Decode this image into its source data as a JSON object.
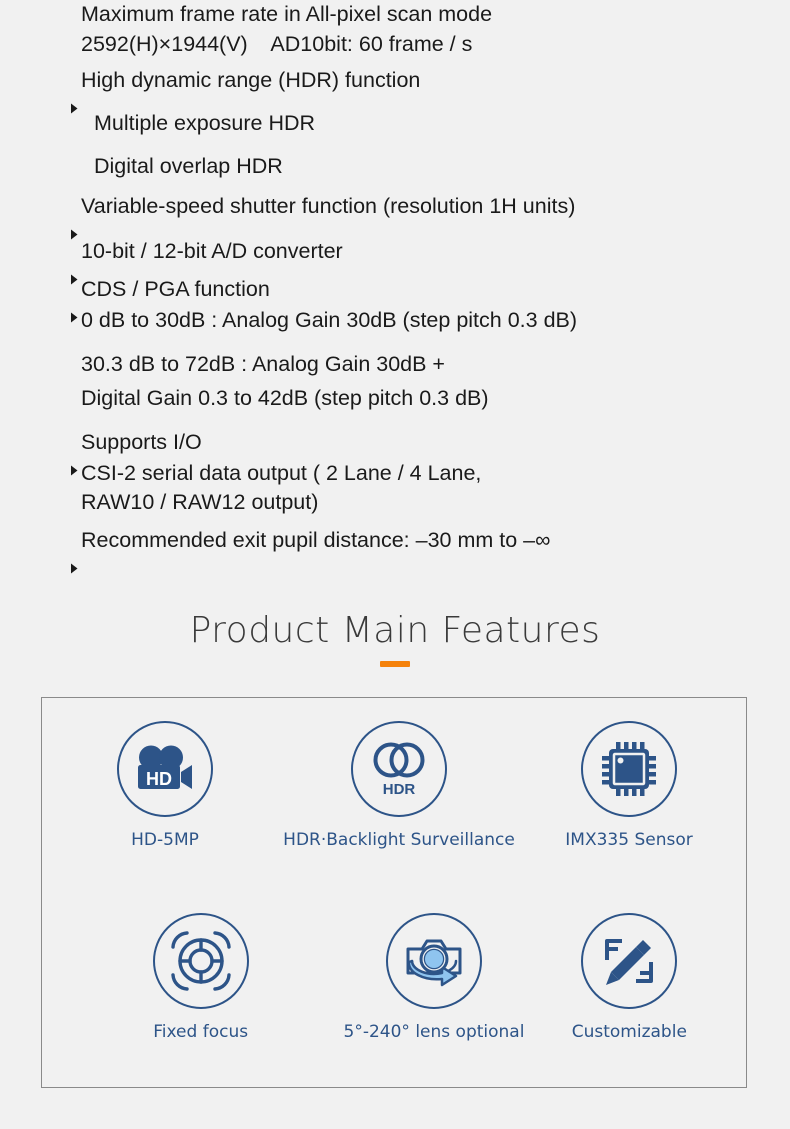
{
  "colors": {
    "page_background": "#f1f1f1",
    "spec_text": "#1a1a1a",
    "heading_text": "#3a3a3a",
    "heading_accent": "#f5820b",
    "feature_blue": "#2d5488",
    "feature_light_blue": "#8fc4ef",
    "box_border": "#8a8a8a"
  },
  "spec_list": {
    "lines": [
      {
        "bullet": false,
        "text": "Maximum frame rate in All-pixel scan mode"
      },
      {
        "bullet": false,
        "text": "2592(H)×1944(V)    AD10bit: 60 frame / s"
      },
      {
        "bullet": true,
        "text": "High dynamic range (HDR) function"
      },
      {
        "bullet": false,
        "text": "Multiple exposure HDR"
      },
      {
        "bullet": false,
        "text": "Digital overlap HDR"
      },
      {
        "bullet": true,
        "text": "Variable-speed shutter function (resolution 1H units)"
      },
      {
        "bullet": true,
        "text": "10-bit / 12-bit A/D converter"
      },
      {
        "bullet": true,
        "text": "CDS / PGA function"
      },
      {
        "bullet": false,
        "text": "0 dB to 30dB : Analog Gain 30dB (step pitch 0.3 dB)"
      },
      {
        "bullet": false,
        "text": "30.3 dB to 72dB : Analog Gain 30dB +"
      },
      {
        "bullet": false,
        "text": "Digital Gain 0.3 to 42dB (step pitch 0.3 dB)"
      },
      {
        "bullet": true,
        "text": "Supports I/O"
      },
      {
        "bullet": false,
        "text": "CSI-2 serial data output ( 2 Lane / 4 Lane,"
      },
      {
        "bullet": false,
        "text": "RAW10 / RAW12 output)"
      },
      {
        "bullet": true,
        "text": "Recommended exit pupil distance: –30 mm to –∞"
      }
    ]
  },
  "features_section": {
    "heading": "Product Main Features",
    "items": [
      {
        "id": "hd5mp",
        "icon": "video-camera-hd-icon",
        "icon_text": "HD",
        "label": "HD-5MP"
      },
      {
        "id": "hdr",
        "icon": "hdr-overlapping-circles-icon",
        "icon_text": "HDR",
        "label": "HDR·Backlight Surveillance"
      },
      {
        "id": "imx335",
        "icon": "sensor-chip-icon",
        "icon_text": "",
        "label": "IMX335 Sensor"
      },
      {
        "id": "fixedfocus",
        "icon": "lens-focus-ring-icon",
        "icon_text": "",
        "label": "Fixed focus"
      },
      {
        "id": "lens",
        "icon": "camera-rotate-icon",
        "icon_text": "",
        "label": "5°-240° lens optional"
      },
      {
        "id": "custom",
        "icon": "pencil-edit-icon",
        "icon_text": "",
        "label": "Customizable"
      }
    ]
  }
}
